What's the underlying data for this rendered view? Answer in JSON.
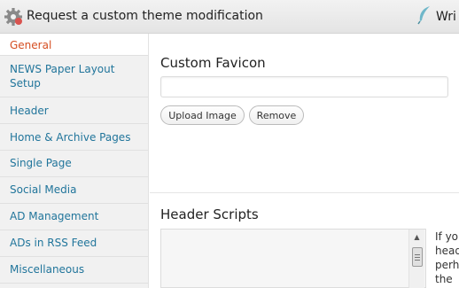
{
  "header": {
    "title": "Request a custom theme modification",
    "write_label": "Wri"
  },
  "sidebar": {
    "items": [
      {
        "label": "General",
        "active": true
      },
      {
        "label": "NEWS Paper Layout Setup"
      },
      {
        "label": "Header"
      },
      {
        "label": "Home & Archive Pages"
      },
      {
        "label": "Single Page"
      },
      {
        "label": "Social Media"
      },
      {
        "label": "AD Management"
      },
      {
        "label": "ADs in RSS Feed"
      },
      {
        "label": "Miscellaneous"
      }
    ]
  },
  "main": {
    "favicon": {
      "label": "Custom Favicon",
      "value": "",
      "upload_label": "Upload Image",
      "remove_label": "Remove"
    },
    "header_scripts": {
      "label": "Header Scripts",
      "value": "",
      "help_lines": [
        "If yo",
        "head",
        "perh",
        "the"
      ]
    }
  },
  "colors": {
    "link": "#21759b",
    "active_link": "#d54e21",
    "sidebar_bg": "#f1f1f1"
  },
  "icons": [
    "gear-icon",
    "quill-icon",
    "scroll-up-icon"
  ]
}
